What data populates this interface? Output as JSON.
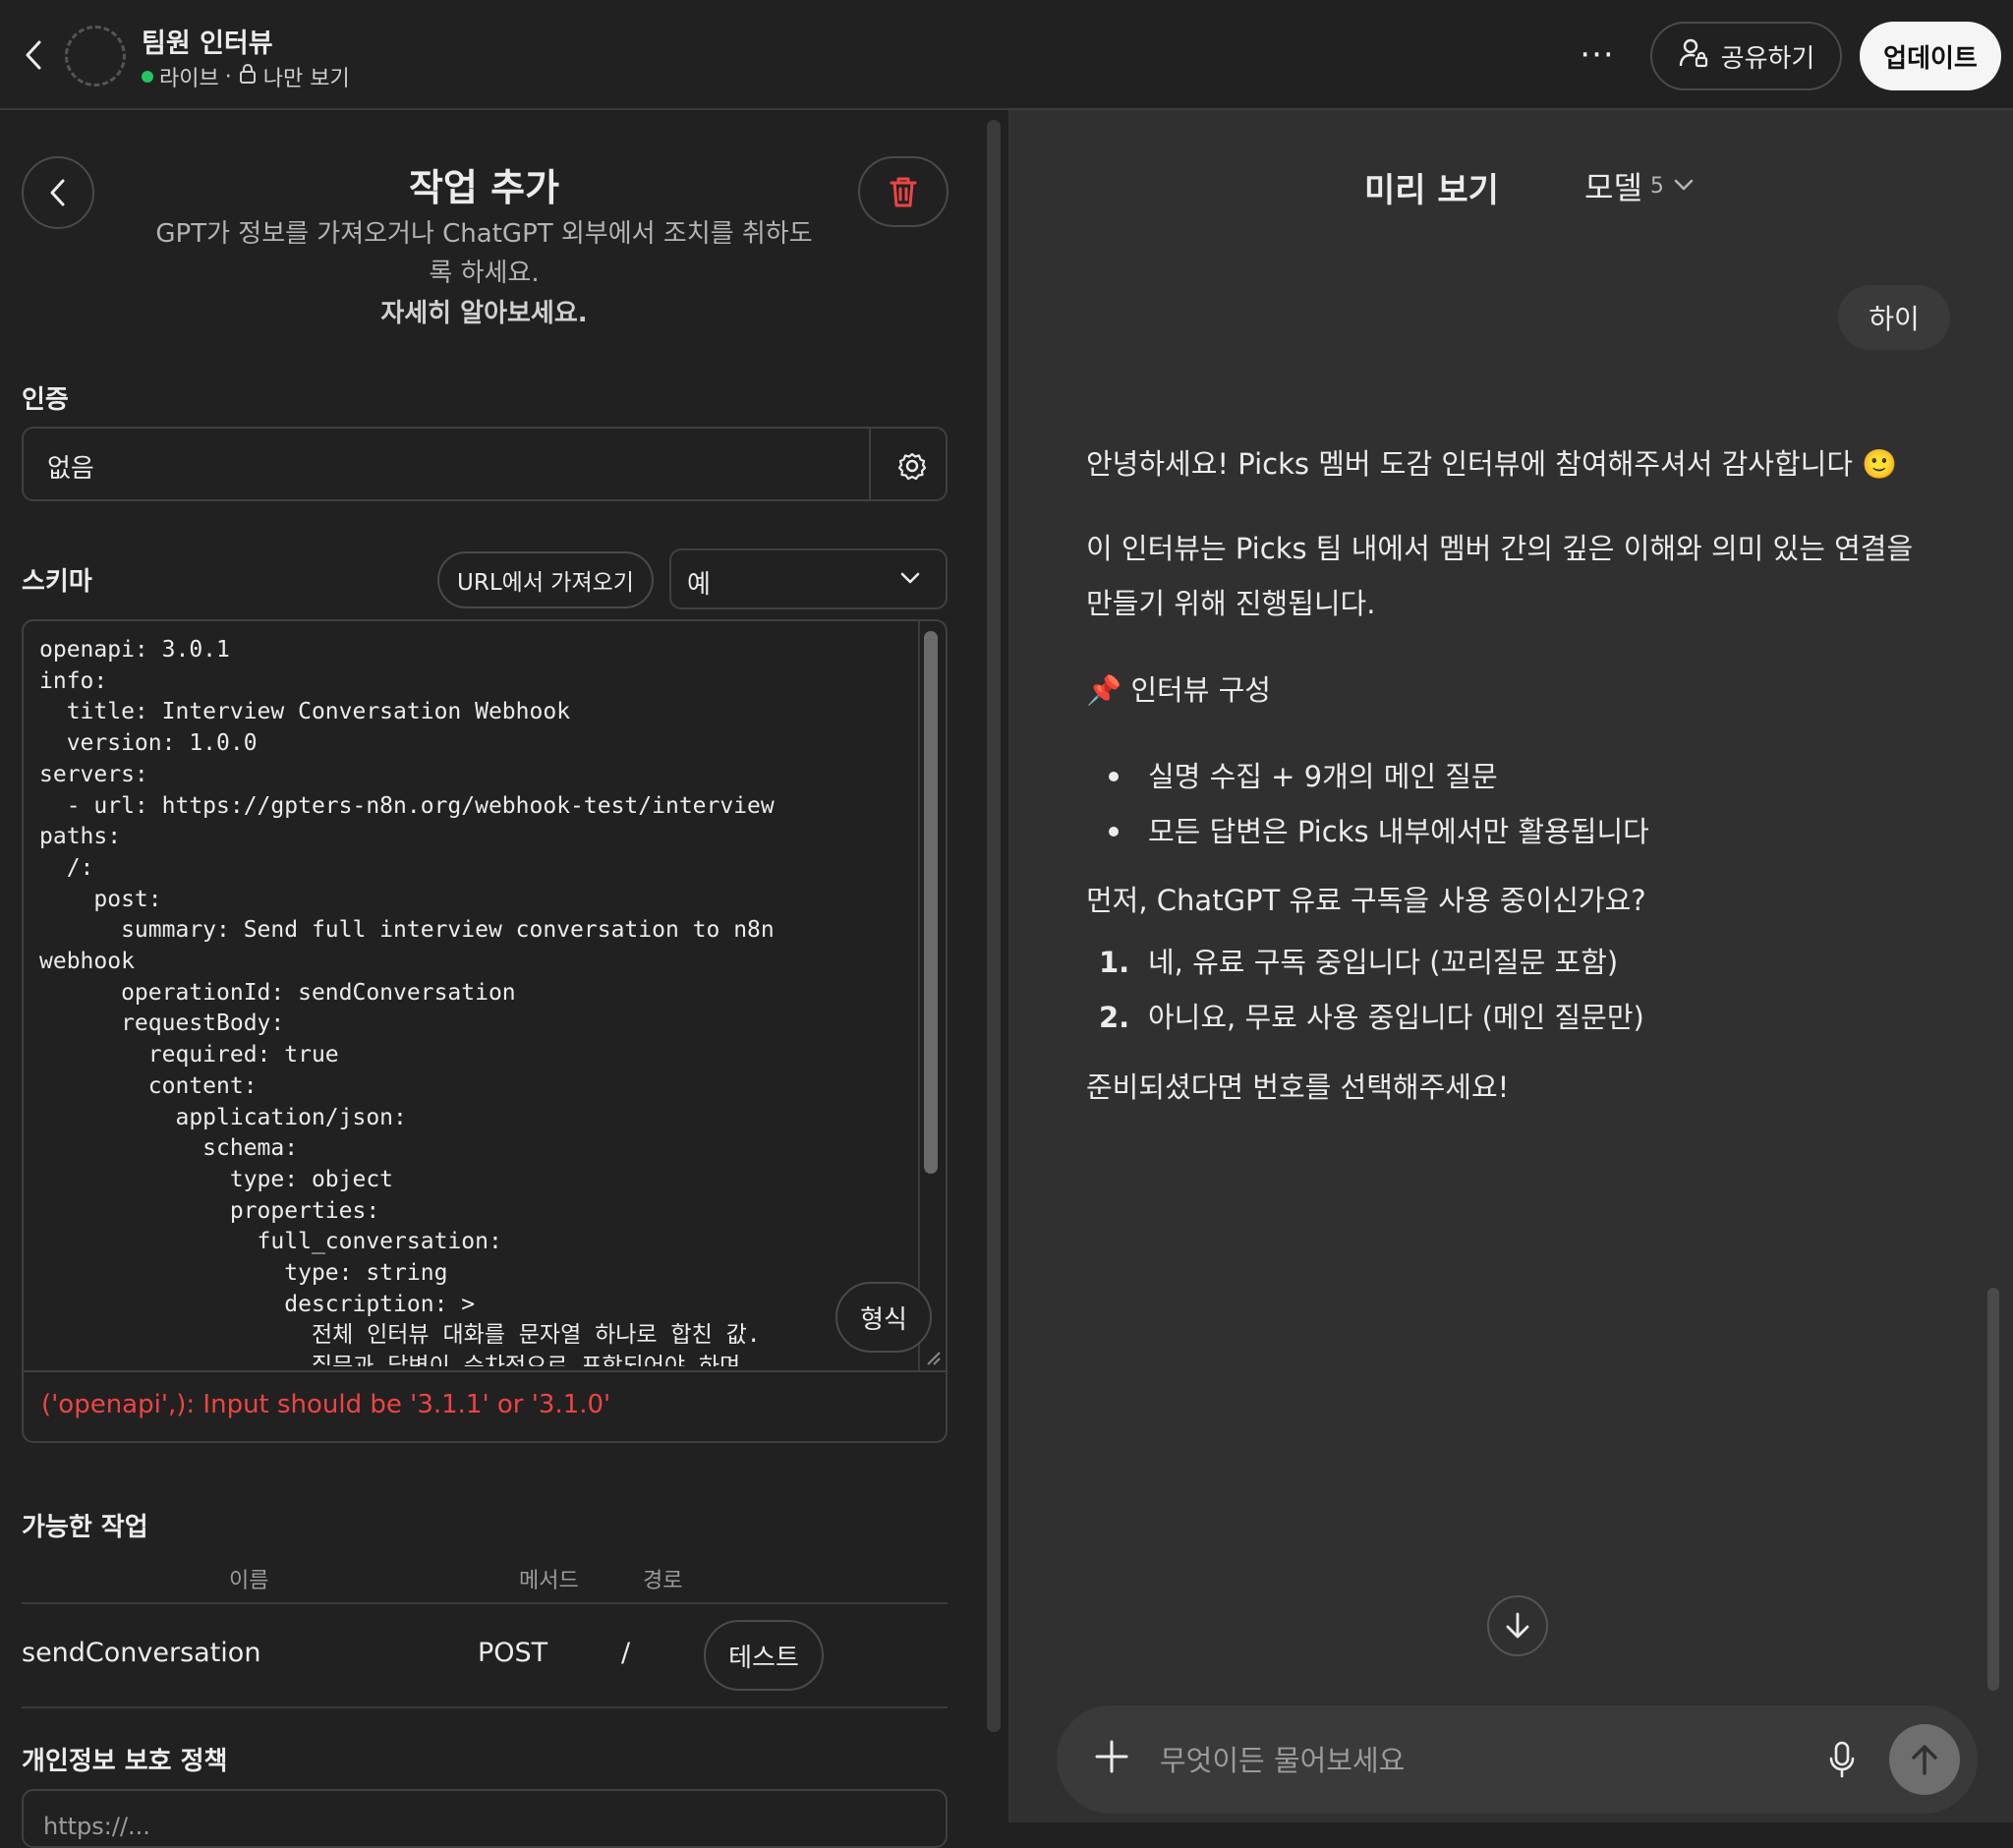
{
  "header": {
    "gpt_name": "팀원 인터뷰",
    "status_live": "라이브",
    "status_separator": "·",
    "visibility": "나만 보기",
    "more_label": "···",
    "share_label": "공유하기",
    "update_label": "업데이트"
  },
  "action_editor": {
    "title": "작업 추가",
    "description": "GPT가 정보를 가져오거나 ChatGPT 외부에서 조치를 취하도록 하세요.",
    "learn_more": "자세히 알아보세요.",
    "auth": {
      "label": "인증",
      "value": "없음"
    },
    "schema": {
      "label": "스키마",
      "import_url_label": "URL에서 가져오기",
      "examples_value": "예",
      "code": "openapi: 3.0.1\ninfo:\n  title: Interview Conversation Webhook\n  version: 1.0.0\nservers:\n  - url: https://gpters-n8n.org/webhook-test/interview\npaths:\n  /:\n    post:\n      summary: Send full interview conversation to n8n\nwebhook\n      operationId: sendConversation\n      requestBody:\n        required: true\n        content:\n          application/json:\n            schema:\n              type: object\n              properties:\n                full_conversation:\n                  type: string\n                  description: >\n                    전체 인터뷰 대화를 문자열 하나로 합친 값.\n                    질문과 답변이 순차적으로 포함되어야 하며",
      "format_label": "형식",
      "error": "('openapi',): Input should be '3.1.1' or '3.1.0'"
    },
    "available_actions": {
      "label": "가능한 작업",
      "columns": [
        "이름",
        "메서드",
        "경로"
      ],
      "rows": [
        {
          "name": "sendConversation",
          "method": "POST",
          "path": "/",
          "test_label": "테스트"
        }
      ]
    },
    "privacy": {
      "label": "개인정보 보호 정책",
      "value": "https://..."
    }
  },
  "preview": {
    "title": "미리 보기",
    "model_label": "모델",
    "model_version": "5",
    "user_message": "하이",
    "assistant": {
      "p1": "안녕하세요! Picks 멤버 도감 인터뷰에 참여해주셔서 감사합니다 🙂",
      "p2_line1": "이 인터뷰는 Picks 팀 내에서 멤버 간의 깊은 이해와 의미 있는 연결을",
      "p2_line2": "만들기 위해 진행됩니다.",
      "section_emoji": "📌",
      "section_title": "인터뷰 구성",
      "bullets": [
        "실명 수집 + 9개의 메인 질문",
        "모든 답변은 Picks 내부에서만 활용됩니다"
      ],
      "question": "먼저, ChatGPT 유료 구독을 사용 중이신가요?",
      "options": [
        {
          "num": "1.",
          "text": "네, 유료 구독 중입니다 (꼬리질문 포함)"
        },
        {
          "num": "2.",
          "text": "아니요, 무료 사용 중입니다 (메인 질문만)"
        }
      ],
      "closing": "준비되셨다면 번호를 선택해주세요!"
    },
    "composer_placeholder": "무엇이든 물어보세요"
  },
  "colors": {
    "background": "#212121",
    "preview_background": "#303030",
    "error": "#ef4444",
    "delete_icon": "#ef4444",
    "live_dot": "#22c55e"
  }
}
